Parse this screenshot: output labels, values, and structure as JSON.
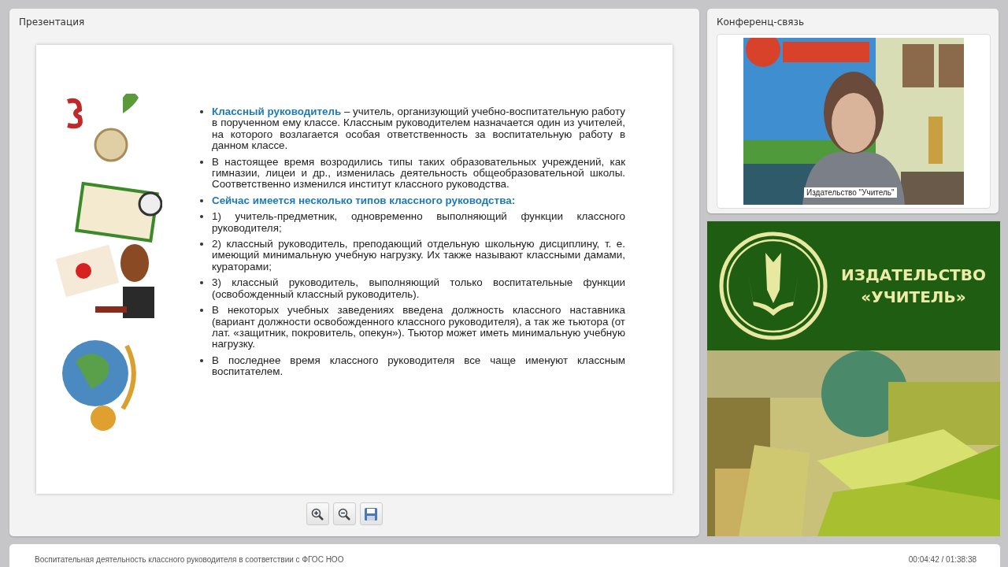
{
  "presentation": {
    "title": "Презентация",
    "slide": {
      "bullets": [
        {
          "kind": "text",
          "text": "**Классный руководитель** – учитель, организующий учебно-воспитательную работу в порученном ему классе. Классным руководителем назначается один из учителей, на которого возлагается особая ответственность за воспитательную работу в данном классе."
        },
        {
          "kind": "text",
          "text": "В настоящее время возродились типы таких образовательных учреждений, как гимназии, лицеи и др., изменилась деятельность общеобразовательной школы. Соответственно изменился институт классного руководства."
        },
        {
          "kind": "heading",
          "text": "Сейчас имеется несколько типов классного руководства:"
        },
        {
          "kind": "text",
          "text": "1) учитель-предметник, одновременно выполняющий функции классного руководителя;"
        },
        {
          "kind": "text",
          "text": "2) классный руководитель, преподающий отдельную школьную дисциплину, т. е. имеющий минимальную учебную нагрузку. Их также называют классными дамами, кураторами;"
        },
        {
          "kind": "text",
          "text": "3) классный руководитель, выполняющий только воспитательные функции (освобожденный классный руководитель)."
        },
        {
          "kind": "text",
          "text": "В некоторых учебных заведениях введена должность классного наставника (вариант должности освобожденного классного руководителя), а так же тьютора (от лат. «защитник, покровитель, опекун»). Тьютор может иметь минимальную учебную нагрузку."
        },
        {
          "kind": "text",
          "text": "В последнее время классного руководителя все чаще именуют классным воспитателем."
        }
      ]
    },
    "toolbar": [
      {
        "kind": "zoom-in"
      },
      {
        "kind": "zoom-out"
      },
      {
        "kind": "save"
      }
    ]
  },
  "conference": {
    "title": "Конференц-связь",
    "video": {
      "kind": "picture",
      "caption": "Издательство \"Учитель\""
    }
  },
  "logo_banner": {
    "line_1": "ИЗДАТЕЛЬСТВО",
    "line_2": "«УЧИТЕЛЬ»"
  },
  "status_bar": {
    "title": "Воспитательная деятельность классного руководителя в соответствии с ФГОС НОО",
    "time": "00:04:42 / 01:38:38"
  }
}
